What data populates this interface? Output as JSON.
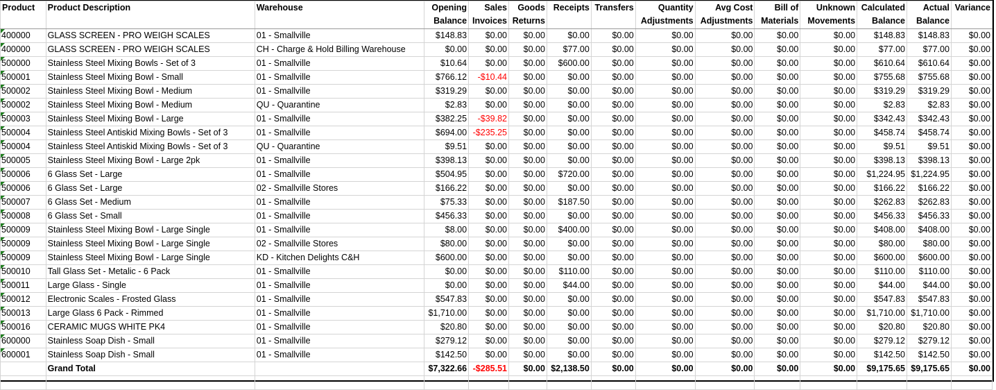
{
  "columns": [
    {
      "key": "product",
      "line1": "Product",
      "line2": ""
    },
    {
      "key": "description",
      "line1": "Product Description",
      "line2": ""
    },
    {
      "key": "warehouse",
      "line1": "Warehouse",
      "line2": ""
    },
    {
      "key": "opening",
      "line1": "Opening",
      "line2": "Balance"
    },
    {
      "key": "sales",
      "line1": "Sales",
      "line2": "Invoices"
    },
    {
      "key": "goods",
      "line1": "Goods",
      "line2": "Returns"
    },
    {
      "key": "receipts",
      "line1": "Receipts",
      "line2": ""
    },
    {
      "key": "transfers",
      "line1": "Transfers",
      "line2": ""
    },
    {
      "key": "qty_adj",
      "line1": "Quantity",
      "line2": "Adjustments"
    },
    {
      "key": "avg_cost",
      "line1": "Avg Cost",
      "line2": "Adjustments"
    },
    {
      "key": "bom",
      "line1": "Bill of",
      "line2": "Materials"
    },
    {
      "key": "unknown",
      "line1": "Unknown",
      "line2": "Movements"
    },
    {
      "key": "calculated",
      "line1": "Calculated",
      "line2": "Balance"
    },
    {
      "key": "actual",
      "line1": "Actual",
      "line2": "Balance"
    },
    {
      "key": "variance",
      "line1": "Variance",
      "line2": ""
    }
  ],
  "rows": [
    [
      "400000",
      "GLASS SCREEN - PRO WEIGH SCALES",
      "01 - Smallville",
      "$148.83",
      "$0.00",
      "$0.00",
      "$0.00",
      "$0.00",
      "$0.00",
      "$0.00",
      "$0.00",
      "$0.00",
      "$148.83",
      "$148.83",
      "$0.00"
    ],
    [
      "400000",
      "GLASS SCREEN - PRO WEIGH SCALES",
      "CH - Charge & Hold Billing Warehouse",
      "$0.00",
      "$0.00",
      "$0.00",
      "$77.00",
      "$0.00",
      "$0.00",
      "$0.00",
      "$0.00",
      "$0.00",
      "$77.00",
      "$77.00",
      "$0.00"
    ],
    [
      "500000",
      "Stainless Steel Mixing Bowls - Set of 3",
      "01 - Smallville",
      "$10.64",
      "$0.00",
      "$0.00",
      "$600.00",
      "$0.00",
      "$0.00",
      "$0.00",
      "$0.00",
      "$0.00",
      "$610.64",
      "$610.64",
      "$0.00"
    ],
    [
      "500001",
      "Stainless Steel Mixing Bowl - Small",
      "01 - Smallville",
      "$766.12",
      "-$10.44",
      "$0.00",
      "$0.00",
      "$0.00",
      "$0.00",
      "$0.00",
      "$0.00",
      "$0.00",
      "$755.68",
      "$755.68",
      "$0.00"
    ],
    [
      "500002",
      "Stainless Steel Mixing Bowl - Medium",
      "01 - Smallville",
      "$319.29",
      "$0.00",
      "$0.00",
      "$0.00",
      "$0.00",
      "$0.00",
      "$0.00",
      "$0.00",
      "$0.00",
      "$319.29",
      "$319.29",
      "$0.00"
    ],
    [
      "500002",
      "Stainless Steel Mixing Bowl - Medium",
      "QU - Quarantine",
      "$2.83",
      "$0.00",
      "$0.00",
      "$0.00",
      "$0.00",
      "$0.00",
      "$0.00",
      "$0.00",
      "$0.00",
      "$2.83",
      "$2.83",
      "$0.00"
    ],
    [
      "500003",
      "Stainless Steel Mixing Bowl - Large",
      "01 - Smallville",
      "$382.25",
      "-$39.82",
      "$0.00",
      "$0.00",
      "$0.00",
      "$0.00",
      "$0.00",
      "$0.00",
      "$0.00",
      "$342.43",
      "$342.43",
      "$0.00"
    ],
    [
      "500004",
      "Stainless Steel Antiskid Mixing Bowls - Set of 3",
      "01 - Smallville",
      "$694.00",
      "-$235.25",
      "$0.00",
      "$0.00",
      "$0.00",
      "$0.00",
      "$0.00",
      "$0.00",
      "$0.00",
      "$458.74",
      "$458.74",
      "$0.00"
    ],
    [
      "500004",
      "Stainless Steel Antiskid Mixing Bowls - Set of 3",
      "QU - Quarantine",
      "$9.51",
      "$0.00",
      "$0.00",
      "$0.00",
      "$0.00",
      "$0.00",
      "$0.00",
      "$0.00",
      "$0.00",
      "$9.51",
      "$9.51",
      "$0.00"
    ],
    [
      "500005",
      "Stainless Steel Mixing Bowl - Large 2pk",
      "01 - Smallville",
      "$398.13",
      "$0.00",
      "$0.00",
      "$0.00",
      "$0.00",
      "$0.00",
      "$0.00",
      "$0.00",
      "$0.00",
      "$398.13",
      "$398.13",
      "$0.00"
    ],
    [
      "500006",
      "6 Glass Set - Large",
      "01 - Smallville",
      "$504.95",
      "$0.00",
      "$0.00",
      "$720.00",
      "$0.00",
      "$0.00",
      "$0.00",
      "$0.00",
      "$0.00",
      "$1,224.95",
      "$1,224.95",
      "$0.00"
    ],
    [
      "500006",
      "6 Glass Set - Large",
      "02 - Smallville Stores",
      "$166.22",
      "$0.00",
      "$0.00",
      "$0.00",
      "$0.00",
      "$0.00",
      "$0.00",
      "$0.00",
      "$0.00",
      "$166.22",
      "$166.22",
      "$0.00"
    ],
    [
      "500007",
      "6 Glass Set - Medium",
      "01 - Smallville",
      "$75.33",
      "$0.00",
      "$0.00",
      "$187.50",
      "$0.00",
      "$0.00",
      "$0.00",
      "$0.00",
      "$0.00",
      "$262.83",
      "$262.83",
      "$0.00"
    ],
    [
      "500008",
      "6 Glass Set - Small",
      "01 - Smallville",
      "$456.33",
      "$0.00",
      "$0.00",
      "$0.00",
      "$0.00",
      "$0.00",
      "$0.00",
      "$0.00",
      "$0.00",
      "$456.33",
      "$456.33",
      "$0.00"
    ],
    [
      "500009",
      "Stainless Steel Mixing Bowl - Large Single",
      "01 - Smallville",
      "$8.00",
      "$0.00",
      "$0.00",
      "$400.00",
      "$0.00",
      "$0.00",
      "$0.00",
      "$0.00",
      "$0.00",
      "$408.00",
      "$408.00",
      "$0.00"
    ],
    [
      "500009",
      "Stainless Steel Mixing Bowl - Large Single",
      "02 - Smallville Stores",
      "$80.00",
      "$0.00",
      "$0.00",
      "$0.00",
      "$0.00",
      "$0.00",
      "$0.00",
      "$0.00",
      "$0.00",
      "$80.00",
      "$80.00",
      "$0.00"
    ],
    [
      "500009",
      "Stainless Steel Mixing Bowl - Large Single",
      "KD - Kitchen Delights C&H",
      "$600.00",
      "$0.00",
      "$0.00",
      "$0.00",
      "$0.00",
      "$0.00",
      "$0.00",
      "$0.00",
      "$0.00",
      "$600.00",
      "$600.00",
      "$0.00"
    ],
    [
      "500010",
      "Tall Glass Set - Metalic - 6 Pack",
      "01 - Smallville",
      "$0.00",
      "$0.00",
      "$0.00",
      "$110.00",
      "$0.00",
      "$0.00",
      "$0.00",
      "$0.00",
      "$0.00",
      "$110.00",
      "$110.00",
      "$0.00"
    ],
    [
      "500011",
      "Large Glass - Single",
      "01 - Smallville",
      "$0.00",
      "$0.00",
      "$0.00",
      "$44.00",
      "$0.00",
      "$0.00",
      "$0.00",
      "$0.00",
      "$0.00",
      "$44.00",
      "$44.00",
      "$0.00"
    ],
    [
      "500012",
      "Electronic Scales - Frosted Glass",
      "01 - Smallville",
      "$547.83",
      "$0.00",
      "$0.00",
      "$0.00",
      "$0.00",
      "$0.00",
      "$0.00",
      "$0.00",
      "$0.00",
      "$547.83",
      "$547.83",
      "$0.00"
    ],
    [
      "500013",
      "Large Glass 6 Pack - Rimmed",
      "01 - Smallville",
      "$1,710.00",
      "$0.00",
      "$0.00",
      "$0.00",
      "$0.00",
      "$0.00",
      "$0.00",
      "$0.00",
      "$0.00",
      "$1,710.00",
      "$1,710.00",
      "$0.00"
    ],
    [
      "500016",
      "CERAMIC MUGS WHITE PK4",
      "01 - Smallville",
      "$20.80",
      "$0.00",
      "$0.00",
      "$0.00",
      "$0.00",
      "$0.00",
      "$0.00",
      "$0.00",
      "$0.00",
      "$20.80",
      "$20.80",
      "$0.00"
    ],
    [
      "600000",
      "Stainless Soap Dish - Small",
      "01 - Smallville",
      "$279.12",
      "$0.00",
      "$0.00",
      "$0.00",
      "$0.00",
      "$0.00",
      "$0.00",
      "$0.00",
      "$0.00",
      "$279.12",
      "$279.12",
      "$0.00"
    ],
    [
      "600001",
      "Stainless Soap Dish - Small",
      "01 - Smallville",
      "$142.50",
      "$0.00",
      "$0.00",
      "$0.00",
      "$0.00",
      "$0.00",
      "$0.00",
      "$0.00",
      "$0.00",
      "$142.50",
      "$142.50",
      "$0.00"
    ]
  ],
  "total": [
    "",
    "Grand Total",
    "",
    "$7,322.66",
    "-$285.51",
    "$0.00",
    "$2,138.50",
    "$0.00",
    "$0.00",
    "$0.00",
    "$0.00",
    "$0.00",
    "$9,175.65",
    "$9,175.65",
    "$0.00"
  ],
  "colors": {
    "negative": "#ff0000",
    "error_indicator": "#1e7c1e",
    "gridline": "#d4d4d4"
  }
}
